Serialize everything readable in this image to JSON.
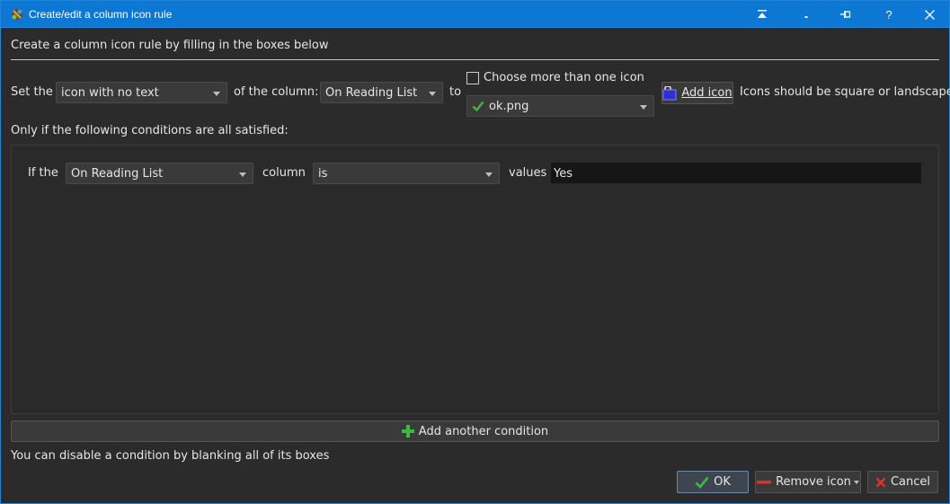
{
  "window": {
    "title": "Create/edit a column icon rule"
  },
  "heading": "Create a column icon rule by filling in the boxes below",
  "rule_row": {
    "set_label": "Set the",
    "kind_value": "icon with no text",
    "of_column_label": "of the column:",
    "column_value": "On Reading List",
    "to_label": "to",
    "multi_checkbox_label": "Choose more than one icon",
    "multi_checked": false,
    "icon_value": "ok.png",
    "add_icon_label": "Add icon",
    "hint": "Icons should be square or landscape"
  },
  "conditions_label": "Only if the following conditions are all satisfied:",
  "condition": {
    "if_label": "If the",
    "column_value": "On Reading List",
    "column_label": "column",
    "op_value": "is",
    "values_label": "values",
    "value": "Yes"
  },
  "add_condition_label": "Add another condition",
  "footer_hint": "You can disable a condition by blanking all of its boxes",
  "buttons": {
    "ok": "OK",
    "remove": "Remove icon",
    "cancel": "Cancel"
  },
  "colors": {
    "titlebar": "#0c78d4",
    "background": "#2b2b2b",
    "green_check": "#3fb83f",
    "red_x": "#e03030"
  }
}
